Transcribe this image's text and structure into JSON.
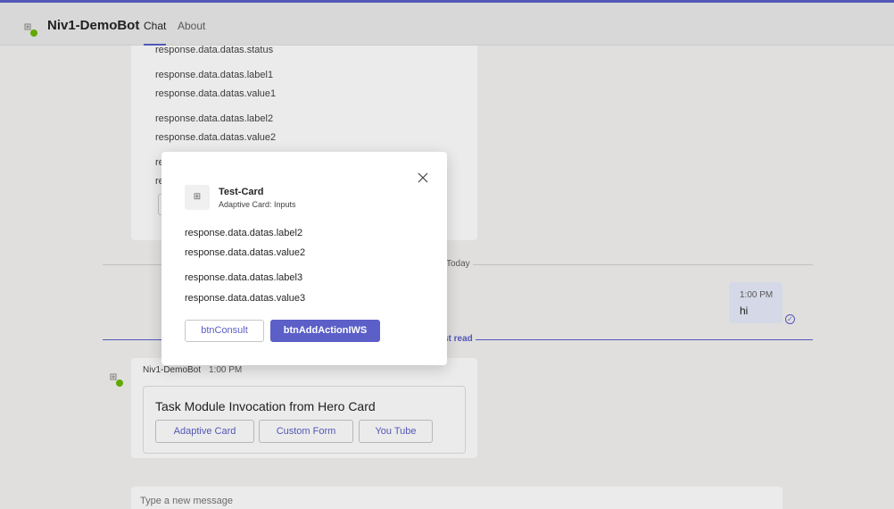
{
  "header": {
    "bot_name": "Niv1-DemoBot",
    "tabs": [
      {
        "label": "Chat",
        "active": true
      },
      {
        "label": "About",
        "active": false
      }
    ]
  },
  "chat": {
    "previous_card_lines": [
      "response.data.datas.status",
      "response.data.datas.label1",
      "response.data.datas.value1",
      "response.data.datas.label2",
      "response.data.datas.value2",
      "re",
      "re"
    ],
    "date_divider": "Today",
    "unread_divider": "st read",
    "my_message": {
      "time": "1:00 PM",
      "text": "hi"
    },
    "bot_message": {
      "sender": "Niv1-DemoBot",
      "time": "1:00 PM",
      "card_title": "Task Module Invocation from Hero Card",
      "buttons": [
        "Adaptive Card",
        "Custom Form",
        "You Tube"
      ]
    },
    "compose_placeholder": "Type a new message"
  },
  "modal": {
    "app_title": "Test-Card",
    "app_subtitle": "Adaptive Card: Inputs",
    "fields": [
      {
        "label": "response.data.datas.label2",
        "value": "response.data.datas.value2"
      },
      {
        "label": "response.data.datas.label3",
        "value": "response.data.datas.value3"
      }
    ],
    "buttons": {
      "secondary": "btnConsult",
      "primary": "btnAddActionIWS"
    },
    "close_icon": "close-icon"
  },
  "colors": {
    "accent": "#5b5fc7",
    "background": "#f3f2f1",
    "card": "#ffffff"
  }
}
